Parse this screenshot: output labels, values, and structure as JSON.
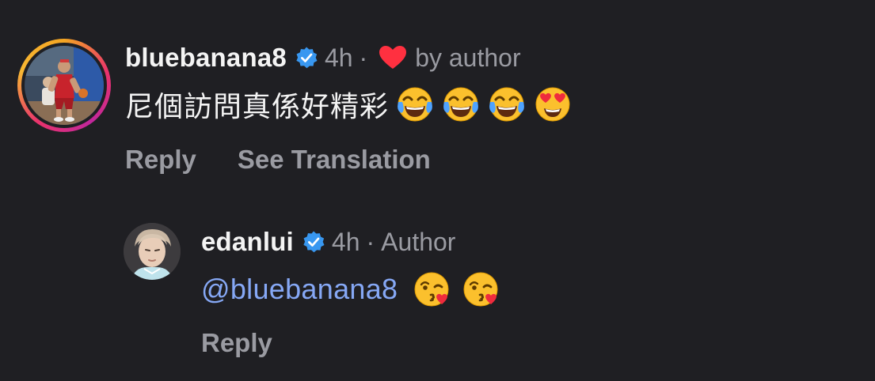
{
  "comment": {
    "username": "bluebanana8",
    "time": "4h",
    "separator": "·",
    "liked_by_author_label": "by author",
    "text": "尼個訪問真係好精彩",
    "emojis": [
      "face-with-tears-of-joy",
      "face-with-tears-of-joy",
      "face-with-tears-of-joy",
      "smiling-face-with-heart-eyes"
    ],
    "actions": {
      "reply": "Reply",
      "see_translation": "See Translation"
    }
  },
  "reply": {
    "username": "edanlui",
    "time": "4h",
    "separator": "·",
    "author_badge": "Author",
    "mention": "@bluebanana8",
    "emojis": [
      "face-blowing-a-kiss",
      "face-blowing-a-kiss"
    ],
    "actions": {
      "reply": "Reply"
    }
  },
  "colors": {
    "background": "#1f1f23",
    "primary_text": "#f4f4f4",
    "secondary_text": "#9a9ba2",
    "verified_blue": "#3897f0",
    "like_red": "#ff3040",
    "mention_blue": "#86a8f5"
  }
}
